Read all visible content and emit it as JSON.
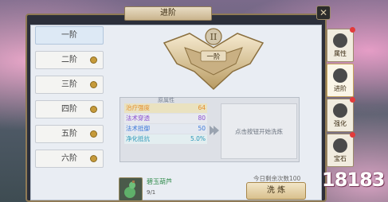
{
  "window": {
    "title": "进阶",
    "close_label": "✕"
  },
  "tiers": [
    {
      "label": "一阶",
      "active": true,
      "locked": false
    },
    {
      "label": "二阶",
      "active": false,
      "locked": true
    },
    {
      "label": "三阶",
      "active": false,
      "locked": true
    },
    {
      "label": "四阶",
      "active": false,
      "locked": true
    },
    {
      "label": "五阶",
      "active": false,
      "locked": true
    },
    {
      "label": "六阶",
      "active": false,
      "locked": true
    }
  ],
  "emblem": {
    "number": "II",
    "label": "一阶"
  },
  "stats": {
    "header": "原属性",
    "rows": [
      {
        "name": "治疗强度",
        "value": "64"
      },
      {
        "name": "法术穿透",
        "value": "80"
      },
      {
        "name": "法术抵御",
        "value": "50"
      },
      {
        "name": "净化抵抗",
        "value": "5.0%"
      }
    ]
  },
  "result": {
    "prompt": "点击按钮开始洗炼"
  },
  "item": {
    "name": "碧玉葫芦",
    "count": "9/1"
  },
  "refine": {
    "remaining": "今日剩余次数100",
    "button_label": "洗 炼"
  },
  "side_tabs": [
    {
      "label": "属性"
    },
    {
      "label": "进阶"
    },
    {
      "label": "强化"
    },
    {
      "label": "宝石"
    }
  ],
  "watermark": "18183"
}
